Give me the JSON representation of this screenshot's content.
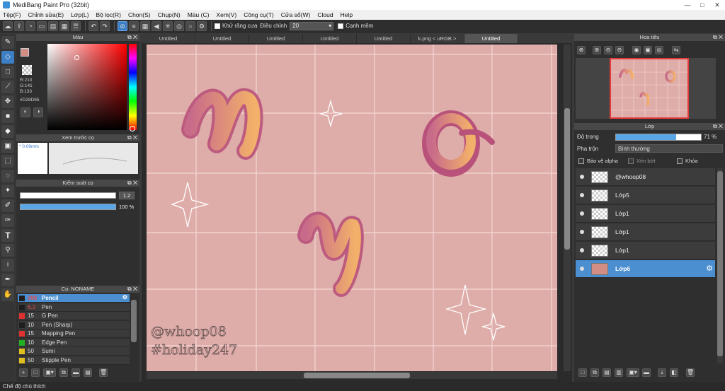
{
  "window": {
    "title": "MediBang Paint Pro (32bit)",
    "minimize": "—",
    "maximize": "□",
    "close": "✕"
  },
  "menu": [
    "Tệp(F)",
    "Chỉnh sửa(E)",
    "Lớp(L)",
    "Bộ lọc(R)",
    "Chọn(S)",
    "Chụp(N)",
    "Màu (C)",
    "Xem(V)",
    "Công cụ(T)",
    "Cửa sổ(W)",
    "Cloud",
    "Help"
  ],
  "toolbar": {
    "antialias_label": "Khử răng cưa",
    "adjust_label": "Điều chỉnh",
    "adjust_value": "20",
    "soft_edge_label": "Cạnh mềm"
  },
  "color_panel": {
    "title": "Màu",
    "rgb_r": "R:210",
    "rgb_g": "G:141",
    "rgb_b": "B:133",
    "hex": "#D28D85",
    "current_color": "#D28D85"
  },
  "brush_preview_panel": {
    "title": "Xem trước cọ",
    "size": "* 0.09mm"
  },
  "brush_control_panel": {
    "title": "Kiểm soát cọ",
    "size_value": "1.2",
    "opacity_value": "100 %"
  },
  "brush_panel": {
    "title": "Cọ: NONAME",
    "items": [
      {
        "size": "396",
        "name": "Pencil",
        "color": "#1e1e1e"
      },
      {
        "size": "6.2",
        "name": "Pen",
        "color": "#1e1e1e"
      },
      {
        "size": "15",
        "name": "G Pen",
        "color": "#e03030"
      },
      {
        "size": "10",
        "name": "Pen (Sharp)",
        "color": "#1e1e1e"
      },
      {
        "size": "15",
        "name": "Mapping Pen",
        "color": "#e03030"
      },
      {
        "size": "10",
        "name": "Edge Pen",
        "color": "#20b020"
      },
      {
        "size": "50",
        "name": "Sumi",
        "color": "#e0c020"
      },
      {
        "size": "50",
        "name": "Stipple Pen",
        "color": "#e0c020"
      }
    ]
  },
  "tabs": [
    "Untitled",
    "Untitled",
    "Untitled",
    "Untitled",
    "Untitled",
    "k.png < uRGB >",
    "Untitled"
  ],
  "canvas": {
    "watermark_1": "@whoop08",
    "watermark_2": "#holiday247",
    "bg_color": "#DFADA9"
  },
  "navigator_panel": {
    "title": "Hoa tiêu"
  },
  "layer_panel": {
    "title": "Lớp",
    "opacity_label": "Độ trong",
    "opacity_value": "71 %",
    "opacity_fraction": 0.71,
    "blend_label": "Pha trộn",
    "blend_value": "Bình thường",
    "protect_alpha": "Bảo vệ alpha",
    "clipping": "Xén bớt",
    "lock": "Khóa",
    "layers": [
      {
        "name": "@whoop08"
      },
      {
        "name": "Lớp5"
      },
      {
        "name": "Lớp1"
      },
      {
        "name": "Lớp1"
      },
      {
        "name": "Lớp1"
      },
      {
        "name": "Lớp6"
      }
    ]
  },
  "statusbar": {
    "text": "Chế độ chú thích"
  }
}
